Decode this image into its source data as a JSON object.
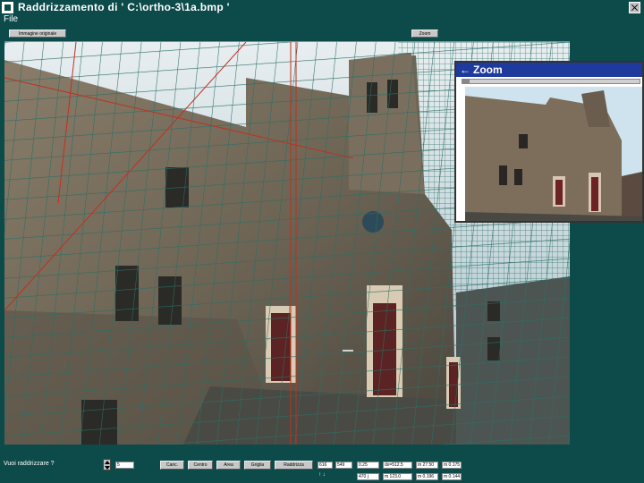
{
  "window": {
    "title": "Raddrizzamento di   ' C:\\ortho-3\\1a.bmp '"
  },
  "menu": {
    "file": "File"
  },
  "toolbar": {
    "left_button": "Immagine originale",
    "right_button": "Zoom"
  },
  "zoom_window": {
    "title": "Zoom",
    "back_arrow": "←"
  },
  "bottom": {
    "prompt": "Vuoi raddrizzare ?",
    "spin_value": "5",
    "buttons": [
      "Canc.",
      "Centro",
      "Area",
      "Griglia",
      "Raddrizza"
    ],
    "field_a": "616",
    "field_b": "549",
    "field_c": "0.25",
    "readout_1": "dx=512.5",
    "readout_2": "m 27.50",
    "readout_3": "m 0.175",
    "arrows": "↑ ↓",
    "readout_4": "470 j",
    "readout_5": "m 123.0",
    "readout_6": "m 0.196",
    "readout_7": "m 0.144"
  },
  "colors": {
    "background": "#0d4a4a",
    "zoom_title": "#1e3a9c",
    "grid": "#2a6e66",
    "guide": "#c03020"
  }
}
